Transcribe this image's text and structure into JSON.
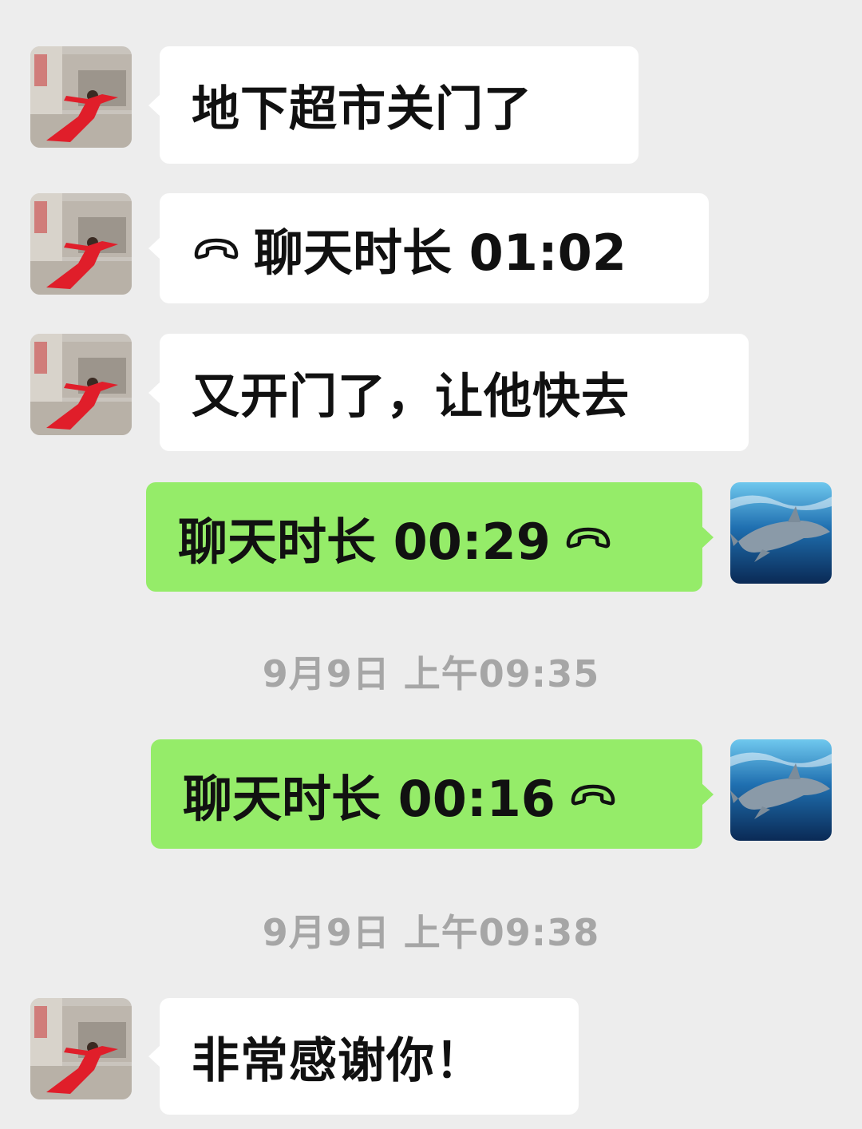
{
  "contacts": {
    "left_avatar": "woman-in-red-photo",
    "right_avatar": "dolphin-photo"
  },
  "colors": {
    "background": "#ededed",
    "incoming_bubble": "#ffffff",
    "outgoing_bubble": "#95ec69",
    "timestamp_text": "#a6a6a6"
  },
  "messages": [
    {
      "direction": "in",
      "text": "地下超市关门了"
    },
    {
      "direction": "in",
      "type": "call",
      "icon": "phone-hangup-icon",
      "text": "聊天时长 01:02"
    },
    {
      "direction": "in",
      "text": "又开门了，让他快去"
    },
    {
      "direction": "out",
      "type": "call",
      "icon": "phone-hangup-icon",
      "text": "聊天时长 00:29"
    },
    {
      "type": "timestamp",
      "text": "9月9日 上午09:35"
    },
    {
      "direction": "out",
      "type": "call",
      "icon": "phone-hangup-icon",
      "text": "聊天时长 00:16"
    },
    {
      "type": "timestamp",
      "text": "9月9日 上午09:38"
    },
    {
      "direction": "in",
      "text": "非常感谢你！"
    }
  ]
}
